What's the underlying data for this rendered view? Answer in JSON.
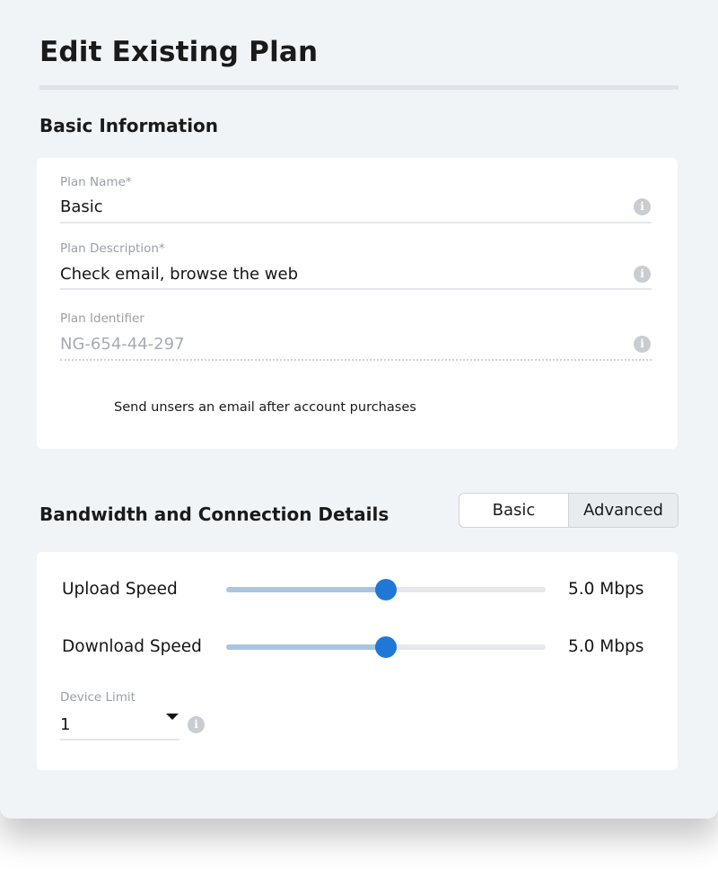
{
  "page": {
    "title": "Edit Existing Plan"
  },
  "basic_info": {
    "section_title": "Basic Information",
    "plan_name": {
      "label": "Plan Name*",
      "value": "Basic",
      "info_icon": "i"
    },
    "plan_description": {
      "label": "Plan Description*",
      "value": "Check email, browse the web",
      "info_icon": "i"
    },
    "plan_identifier": {
      "label": "Plan Identifier",
      "value": "NG-654-44-297",
      "info_icon": "i"
    },
    "email_option": {
      "label": "Send unsers an email after account purchases"
    }
  },
  "bandwidth": {
    "section_title": "Bandwidth and Connection Details",
    "mode_toggle": {
      "options": [
        "Basic",
        "Advanced"
      ],
      "selected": "Advanced"
    },
    "upload": {
      "label": "Upload Speed",
      "value_text": "5.0 Mbps",
      "fraction": 0.5
    },
    "download": {
      "label": "Download Speed",
      "value_text": "5.0 Mbps",
      "fraction": 0.5
    },
    "device_limit": {
      "label": "Device Limit",
      "value": "1",
      "info_icon": "i"
    }
  },
  "colors": {
    "accent": "#1f78d6",
    "track_fill": "#a8c6e2",
    "panel_bg": "#f1f4f7"
  }
}
